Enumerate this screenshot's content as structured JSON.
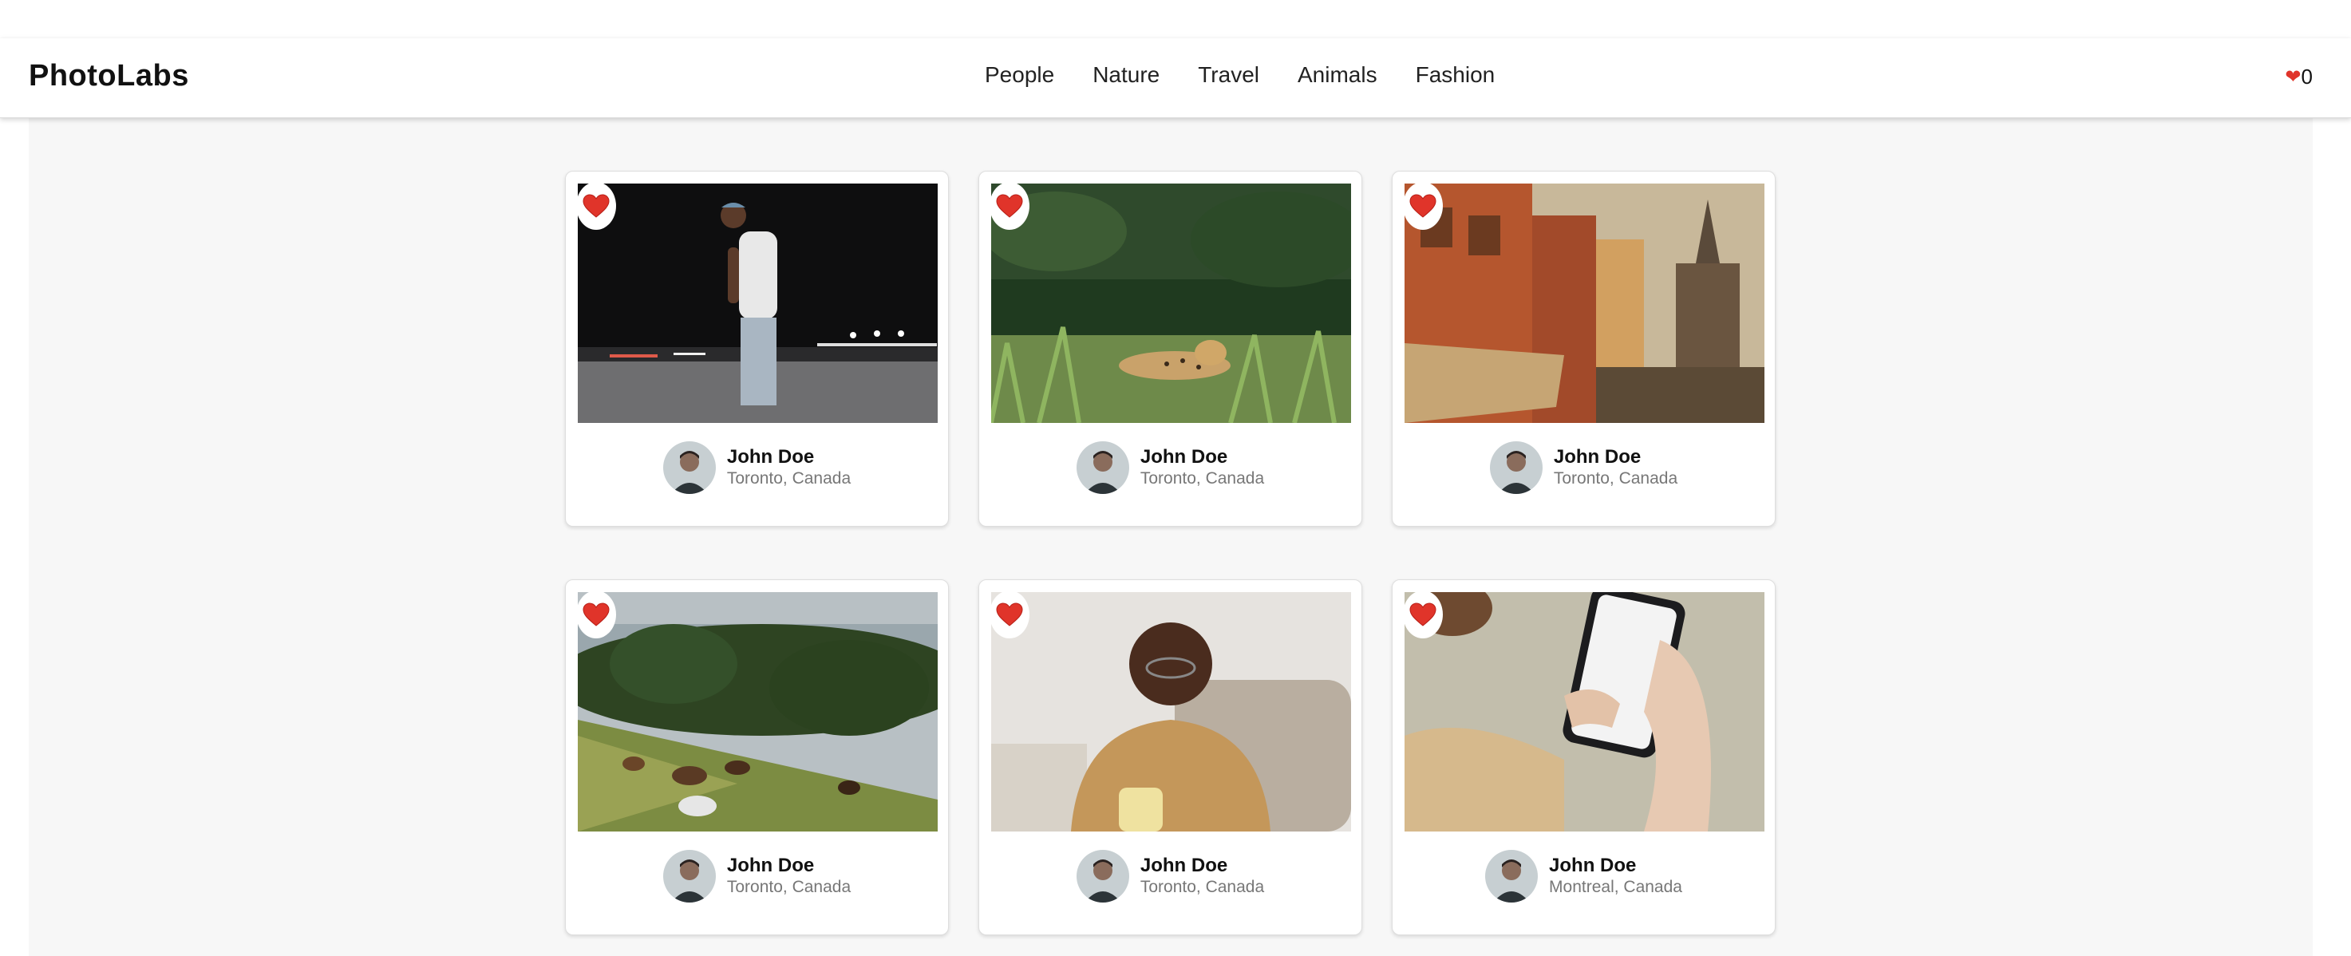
{
  "app": {
    "title": "PhotoLabs"
  },
  "nav": {
    "topics": [
      "People",
      "Nature",
      "Travel",
      "Animals",
      "Fashion"
    ],
    "favorites": {
      "icon": "heart-icon",
      "count": "0"
    }
  },
  "photos": [
    {
      "subject": "man-walking-night-street",
      "liked": true,
      "author": "John Doe",
      "location": "Toronto, Canada"
    },
    {
      "subject": "jaguar-in-grass",
      "liked": true,
      "author": "John Doe",
      "location": "Toronto, Canada"
    },
    {
      "subject": "old-city-buildings",
      "liked": true,
      "author": "John Doe",
      "location": "Toronto, Canada"
    },
    {
      "subject": "horses-grazing-hillside",
      "liked": true,
      "author": "John Doe",
      "location": "Toronto, Canada"
    },
    {
      "subject": "smiling-man-with-mug",
      "liked": true,
      "author": "John Doe",
      "location": "Toronto, Canada"
    },
    {
      "subject": "hand-holding-phone",
      "liked": true,
      "author": "John Doe",
      "location": "Montreal, Canada"
    }
  ],
  "colors": {
    "heart": "#e0342a",
    "background": "#f7f7f7",
    "text": "#111111",
    "muted": "#777777"
  }
}
